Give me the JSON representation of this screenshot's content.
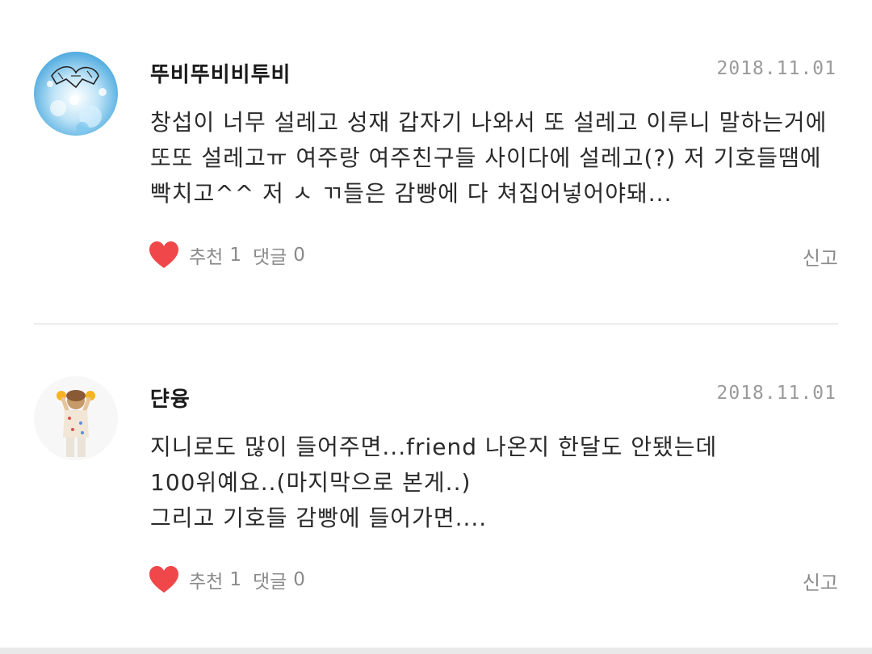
{
  "comments": [
    {
      "avatar_icon": "user-avatar-sparkle",
      "username": "뚜비뚜비비투비",
      "date": "2018.11.01",
      "lines": [
        "창섭이 너무 설레고 성재 갑자기 나와서 또 설레고 이루니 말하는거에",
        "또또 설레고ㅠ 여주랑 여주친구들 사이다에 설레고(?) 저 기호들땜에",
        "빡치고^^ 저 ㅅ ㄲ들은 감빵에 다 쳐집어넣어야돼..."
      ],
      "like_label": "추천",
      "like_count": "1",
      "reply_label": "댓글",
      "reply_count": "0",
      "report_label": "신고"
    },
    {
      "avatar_icon": "user-avatar-photo",
      "username": "댠융",
      "date": "2018.11.01",
      "lines": [
        "지니로도 많이 들어주면...friend 나온지 한달도 안됐는데",
        "100위예요..(마지막으로 본게..)",
        "그리고 기호들 감빵에 들어가면...."
      ],
      "like_label": "추천",
      "like_count": "1",
      "reply_label": "댓글",
      "reply_count": "0",
      "report_label": "신고"
    }
  ],
  "colors": {
    "heart": "#f0474a",
    "muted_text": "#8a8a8a",
    "date_text": "#9a9a9a",
    "divider": "#ececec"
  }
}
